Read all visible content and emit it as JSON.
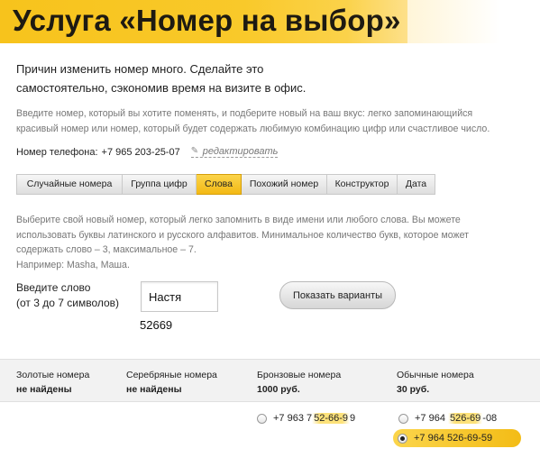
{
  "banner": {
    "title": "Услуга «Номер на выбор»"
  },
  "intro": {
    "line1": "Причин изменить номер много. Сделайте это",
    "line2": "самостоятельно, сэкономив время на визите в офис."
  },
  "description": {
    "line1": "Введите номер, который вы хотите поменять, и подберите новый на ваш вкус: легко запоминающийся",
    "line2": "красивый номер или номер, который будет содержать любимую комбинацию цифр или счастливое число."
  },
  "phone": {
    "label": "Номер телефона:",
    "value": "+7 965 203-25-07",
    "edit_label": "редактировать"
  },
  "tabs": [
    {
      "label": "Случайные номера",
      "active": false
    },
    {
      "label": "Группа цифр",
      "active": false
    },
    {
      "label": "Слова",
      "active": true
    },
    {
      "label": "Похожий номер",
      "active": false
    },
    {
      "label": "Конструктор",
      "active": false
    },
    {
      "label": "Дата",
      "active": false
    }
  ],
  "words_tab": {
    "line1": "Выберите свой новый номер, который легко запомнить в виде имени или любого слова. Вы можете",
    "line2": "использовать буквы латинского и русского алфавитов. Минимальное количество букв, которое может",
    "line3": "содержать слово – 3, максимальное – 7.",
    "line4": "Например: Masha, Маша.",
    "input_label_line1": "Введите слово",
    "input_label_line2": "(от 3 до 7 символов)",
    "input_value": "Настя",
    "digits": "52669",
    "button_label": "Показать варианты"
  },
  "results": {
    "columns": [
      {
        "title": "Золотые номера",
        "sub": "не найдены"
      },
      {
        "title": "Серебряные номера",
        "sub": "не найдены"
      },
      {
        "title": "Бронзовые номера",
        "sub": "1000 руб."
      },
      {
        "title": "Обычные номера",
        "sub": "30 руб."
      }
    ],
    "options": [
      {
        "prefix": "+7 963 7",
        "highlight": "52-66-9",
        "suffix": "9",
        "checked": false
      },
      {
        "prefix": "+7 964 ",
        "highlight": "526-69",
        "suffix": "-08",
        "checked": false
      },
      {
        "prefix": "+7 964 526-69-59",
        "highlight": "",
        "suffix": "",
        "checked": true
      }
    ]
  },
  "colors": {
    "accent": "#f9c423",
    "accent_dark": "#f3b914",
    "muted_text": "#777777"
  }
}
